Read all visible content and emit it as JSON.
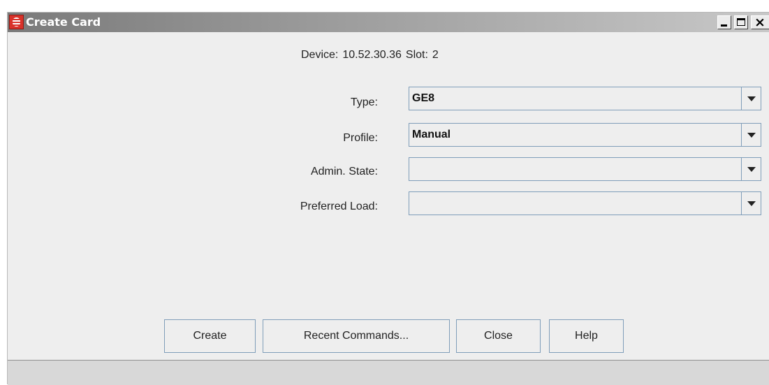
{
  "window": {
    "title": "Create Card",
    "app_icon": "app-logo-icon",
    "controls": [
      "minimize-icon",
      "maximize-icon",
      "close-icon"
    ]
  },
  "header": {
    "device_label": "Device:",
    "device_value": "10.52.30.36",
    "slot_label": "Slot:",
    "slot_value": "2"
  },
  "form": {
    "fields": [
      {
        "label": "Type:",
        "value": "GE8"
      },
      {
        "label": "Profile:",
        "value": "Manual"
      },
      {
        "label": "Admin. State:",
        "value": ""
      },
      {
        "label": "Preferred Load:",
        "value": ""
      }
    ]
  },
  "buttons": {
    "create": "Create",
    "recent_commands": "Recent Commands...",
    "close": "Close",
    "help": "Help"
  },
  "colors": {
    "border_accent": "#7f9db9",
    "window_bg": "#eeeeee",
    "app_icon_red": "#d9322a"
  }
}
